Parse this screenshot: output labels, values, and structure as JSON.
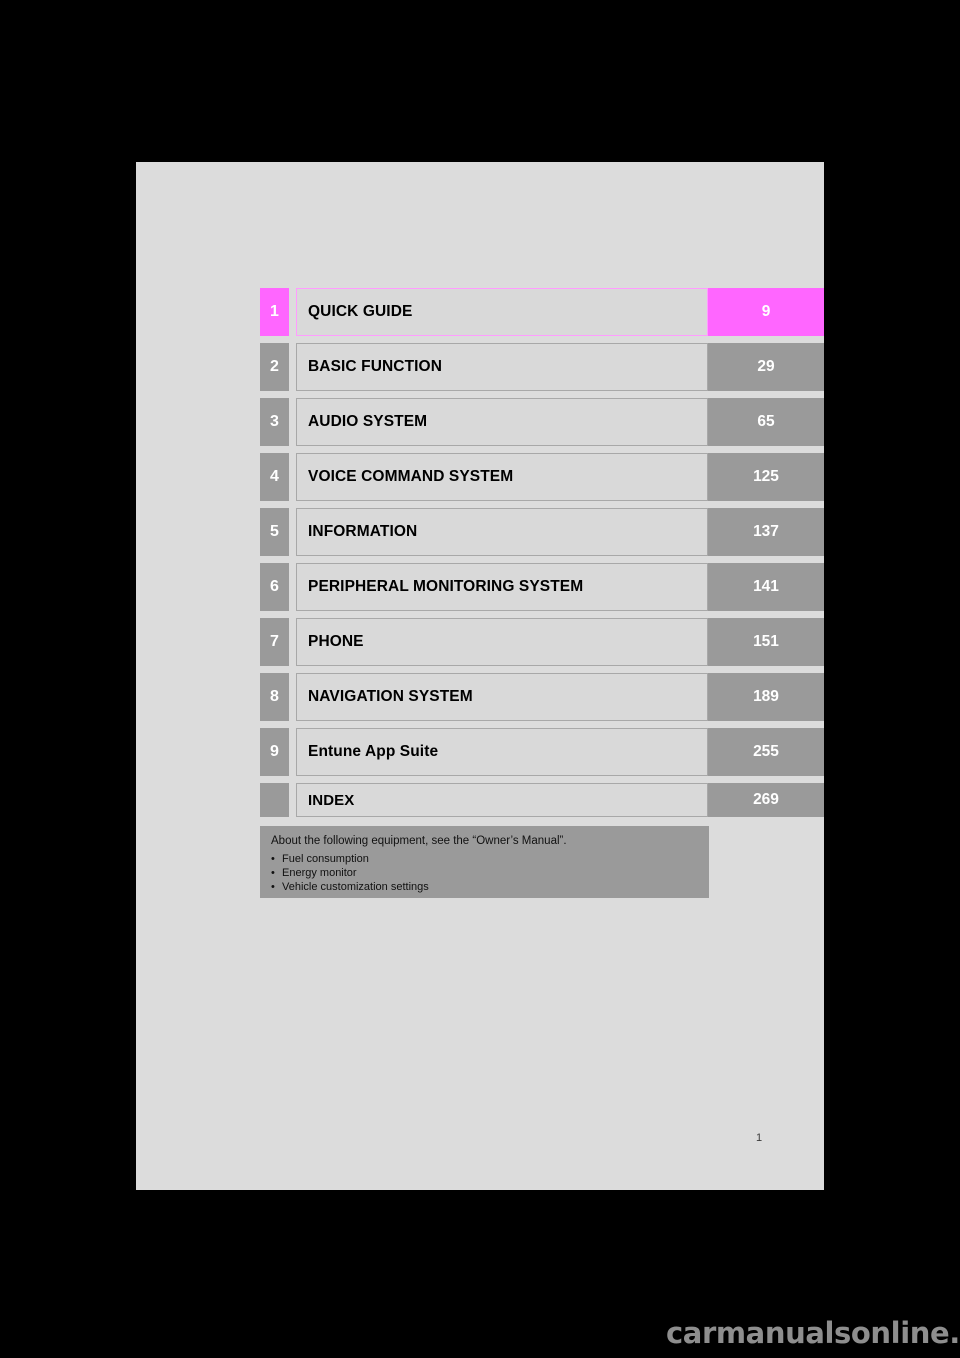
{
  "document": {
    "page_folio": "1",
    "background_color": "#dcdcdc",
    "canvas_color": "#000000"
  },
  "colors": {
    "highlight": "#ff66ff",
    "highlight_border": "#ff9cff",
    "chip_gray": "#9a9a9a",
    "title_box": "#d9d9d9",
    "title_border": "#a8a8a8"
  },
  "chapter_index": {
    "rows": [
      {
        "number": "1",
        "title": "QUICK GUIDE",
        "page": "9",
        "highlight": true
      },
      {
        "number": "2",
        "title": "BASIC FUNCTION",
        "page": "29",
        "highlight": false
      },
      {
        "number": "3",
        "title": "AUDIO SYSTEM",
        "page": "65",
        "highlight": false
      },
      {
        "number": "4",
        "title": "VOICE COMMAND SYSTEM",
        "page": "125",
        "highlight": false
      },
      {
        "number": "5",
        "title": "INFORMATION",
        "page": "137",
        "highlight": false
      },
      {
        "number": "6",
        "title": "PERIPHERAL MONITORING SYSTEM",
        "page": "141",
        "highlight": false
      },
      {
        "number": "7",
        "title": "PHONE",
        "page": "151",
        "highlight": false
      },
      {
        "number": "8",
        "title": "NAVIGATION SYSTEM",
        "page": "189",
        "highlight": false
      },
      {
        "number": "9",
        "title": "Entune App Suite",
        "page": "255",
        "highlight": false
      },
      {
        "number": "",
        "title": "INDEX",
        "page": "269",
        "highlight": false
      }
    ]
  },
  "note_box": {
    "heading": "About the following equipment, see the “Owner’s Manual”.",
    "bullet": "•",
    "items": [
      "Fuel consumption",
      "Energy monitor",
      "Vehicle customization settings"
    ]
  },
  "watermark": {
    "text": "carmanualsonline.info"
  }
}
